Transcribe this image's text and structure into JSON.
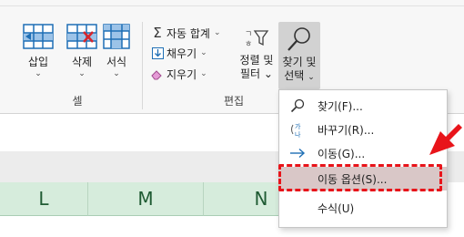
{
  "ribbon": {
    "cells_group": {
      "label": "셀",
      "insert": "삽입",
      "delete": "삭제",
      "format": "서식"
    },
    "edit_group": {
      "label": "편집",
      "autosum": "자동 합계",
      "fill": "채우기",
      "clear": "지우기",
      "sort_filter_line1": "정렬 및",
      "sort_filter_line2": "필터",
      "find_select_line1": "찾기 및",
      "find_select_line2": "선택"
    }
  },
  "columns": [
    "L",
    "M",
    "N"
  ],
  "menu": {
    "items": [
      {
        "label": "찾기(F)...",
        "icon": "search-icon"
      },
      {
        "label": "바꾸기(R)...",
        "icon": "replace-icon"
      },
      {
        "label": "이동(G)...",
        "icon": "arrow-right-icon"
      },
      {
        "label": "이동 옵션(S)...",
        "icon": "none",
        "highlighted": true
      },
      {
        "label": "수식(U)",
        "icon": "none"
      }
    ]
  },
  "colors": {
    "highlight": "#d9c7c7",
    "callout": "#e8141a",
    "column_header": "#d6ecdc"
  }
}
